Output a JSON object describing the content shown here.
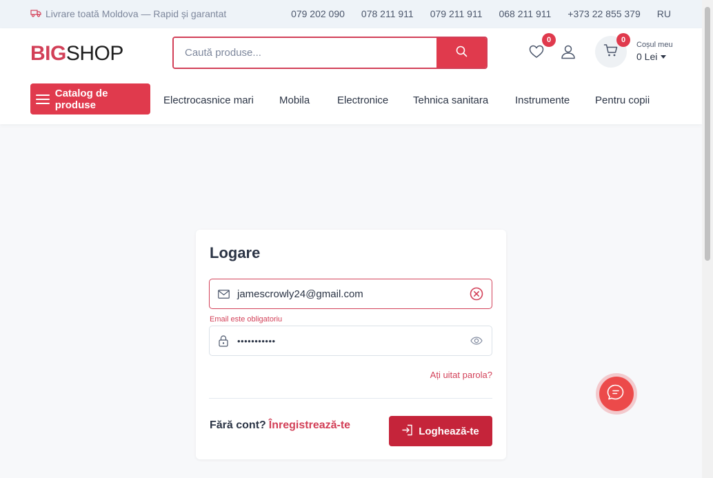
{
  "topbar": {
    "delivery": "Livrare toată Moldova — Rapid și garantat",
    "phones": [
      "079 202 090",
      "078 211 911",
      "079 211 911",
      "068 211 911",
      "+373 22 855 379"
    ],
    "language": "RU"
  },
  "header": {
    "logo_big": "BIG",
    "logo_shop": "SHOP",
    "search_placeholder": "Caută produse...",
    "wishlist_count": "0",
    "cart_count": "0",
    "cart_label": "Coșul meu",
    "cart_value": "0 Lei"
  },
  "nav": {
    "catalog": "Catalog de produse",
    "items": [
      "Electrocasnice mari",
      "Mobila",
      "Electronice",
      "Tehnica sanitara",
      "Instrumente",
      "Pentru copii"
    ]
  },
  "login": {
    "title": "Logare",
    "email_value": "jamescrowly24@gmail.com",
    "email_error": "Email este obligatoriu",
    "password_mask": "•••••••••••",
    "forgot": "Ați uitat parola?",
    "no_account": "Fără cont?",
    "register": "Înregistrează-te",
    "login_button": "Loghează-te"
  },
  "colors": {
    "accent": "#e03a4d",
    "dark_accent": "#c5243a",
    "topbar_bg": "#eef3f8"
  }
}
